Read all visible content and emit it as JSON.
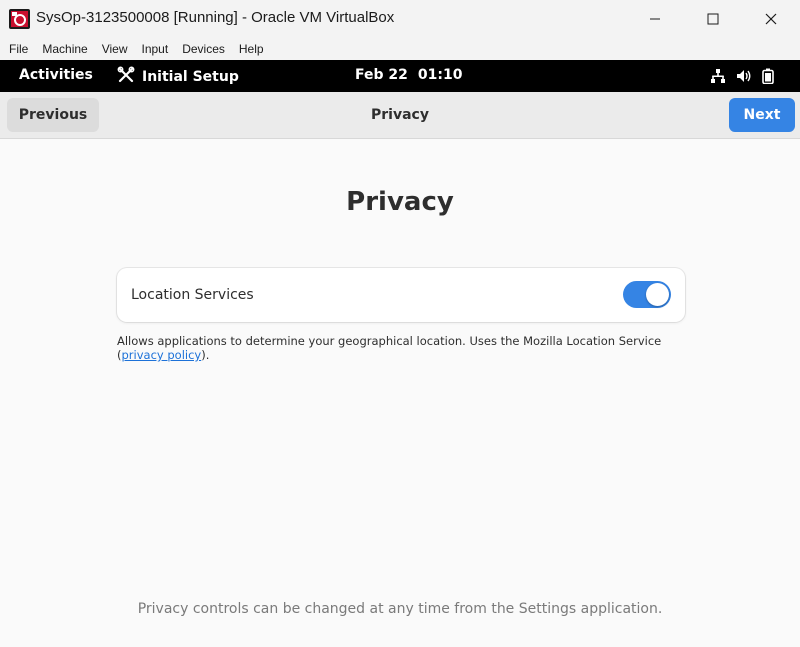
{
  "window": {
    "title": "SysOp-3123500008 [Running] - Oracle VM VirtualBox"
  },
  "menubar": {
    "items": [
      "File",
      "Machine",
      "View",
      "Input",
      "Devices",
      "Help"
    ]
  },
  "topbar": {
    "activities": "Activities",
    "app_name": "Initial Setup",
    "date": "Feb 22",
    "time": "01:10",
    "icons": [
      "network-icon",
      "volume-icon",
      "battery-icon"
    ]
  },
  "headerbar": {
    "previous_label": "Previous",
    "title": "Privacy",
    "next_label": "Next"
  },
  "page": {
    "heading": "Privacy",
    "location_label": "Location Services",
    "location_enabled": true,
    "description_prefix": "Allows applications to determine your geographical location. Uses the Mozilla Location Service (",
    "description_link": "privacy policy",
    "description_suffix": ").",
    "footer": "Privacy controls can be changed at any time from the Settings application."
  },
  "colors": {
    "accent": "#3584e4",
    "topbar_bg": "#000000",
    "link": "#1c71d8"
  }
}
